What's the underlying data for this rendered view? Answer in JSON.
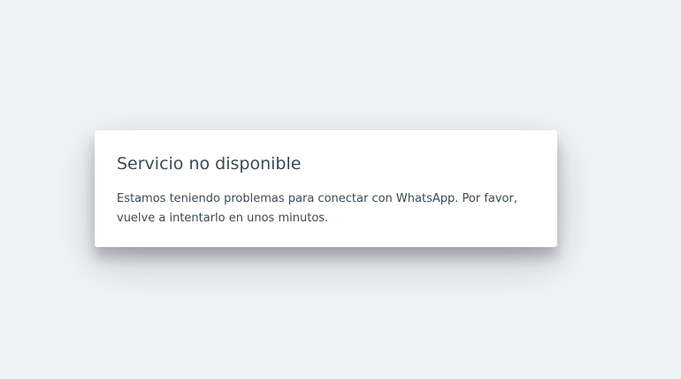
{
  "dialog": {
    "title": "Servicio no disponible",
    "message": "Estamos teniendo problemas para conectar con WhatsApp. Por favor, vuelve a intentarlo en unos minutos."
  },
  "colors": {
    "background": "#f0f2f5",
    "dialog_background": "#ffffff",
    "text": "#3b4a54"
  }
}
